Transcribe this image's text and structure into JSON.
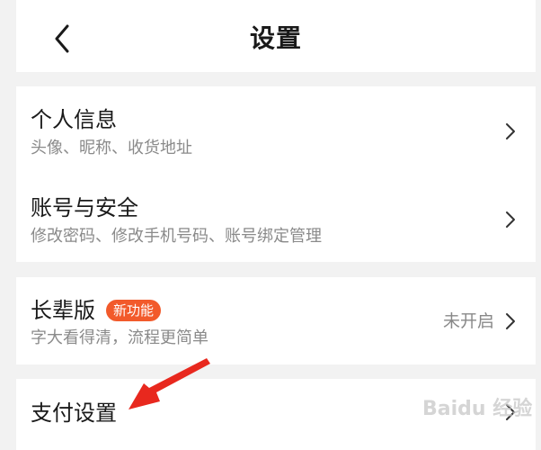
{
  "header": {
    "title": "设置",
    "back_icon": "chevron-left-icon"
  },
  "sections": {
    "personal": {
      "title": "个人信息",
      "subtitle": "头像、昵称、收货地址"
    },
    "account": {
      "title": "账号与安全",
      "subtitle": "修改密码、修改手机号码、账号绑定管理"
    },
    "elder": {
      "title": "长辈版",
      "badge": "新功能",
      "subtitle": "字大看得清，流程更简单",
      "status": "未开启"
    },
    "payment": {
      "title": "支付设置"
    }
  },
  "watermark": "Baidu 经验",
  "colors": {
    "badge": "#f25a2b",
    "annotation_arrow": "#e8281e"
  }
}
